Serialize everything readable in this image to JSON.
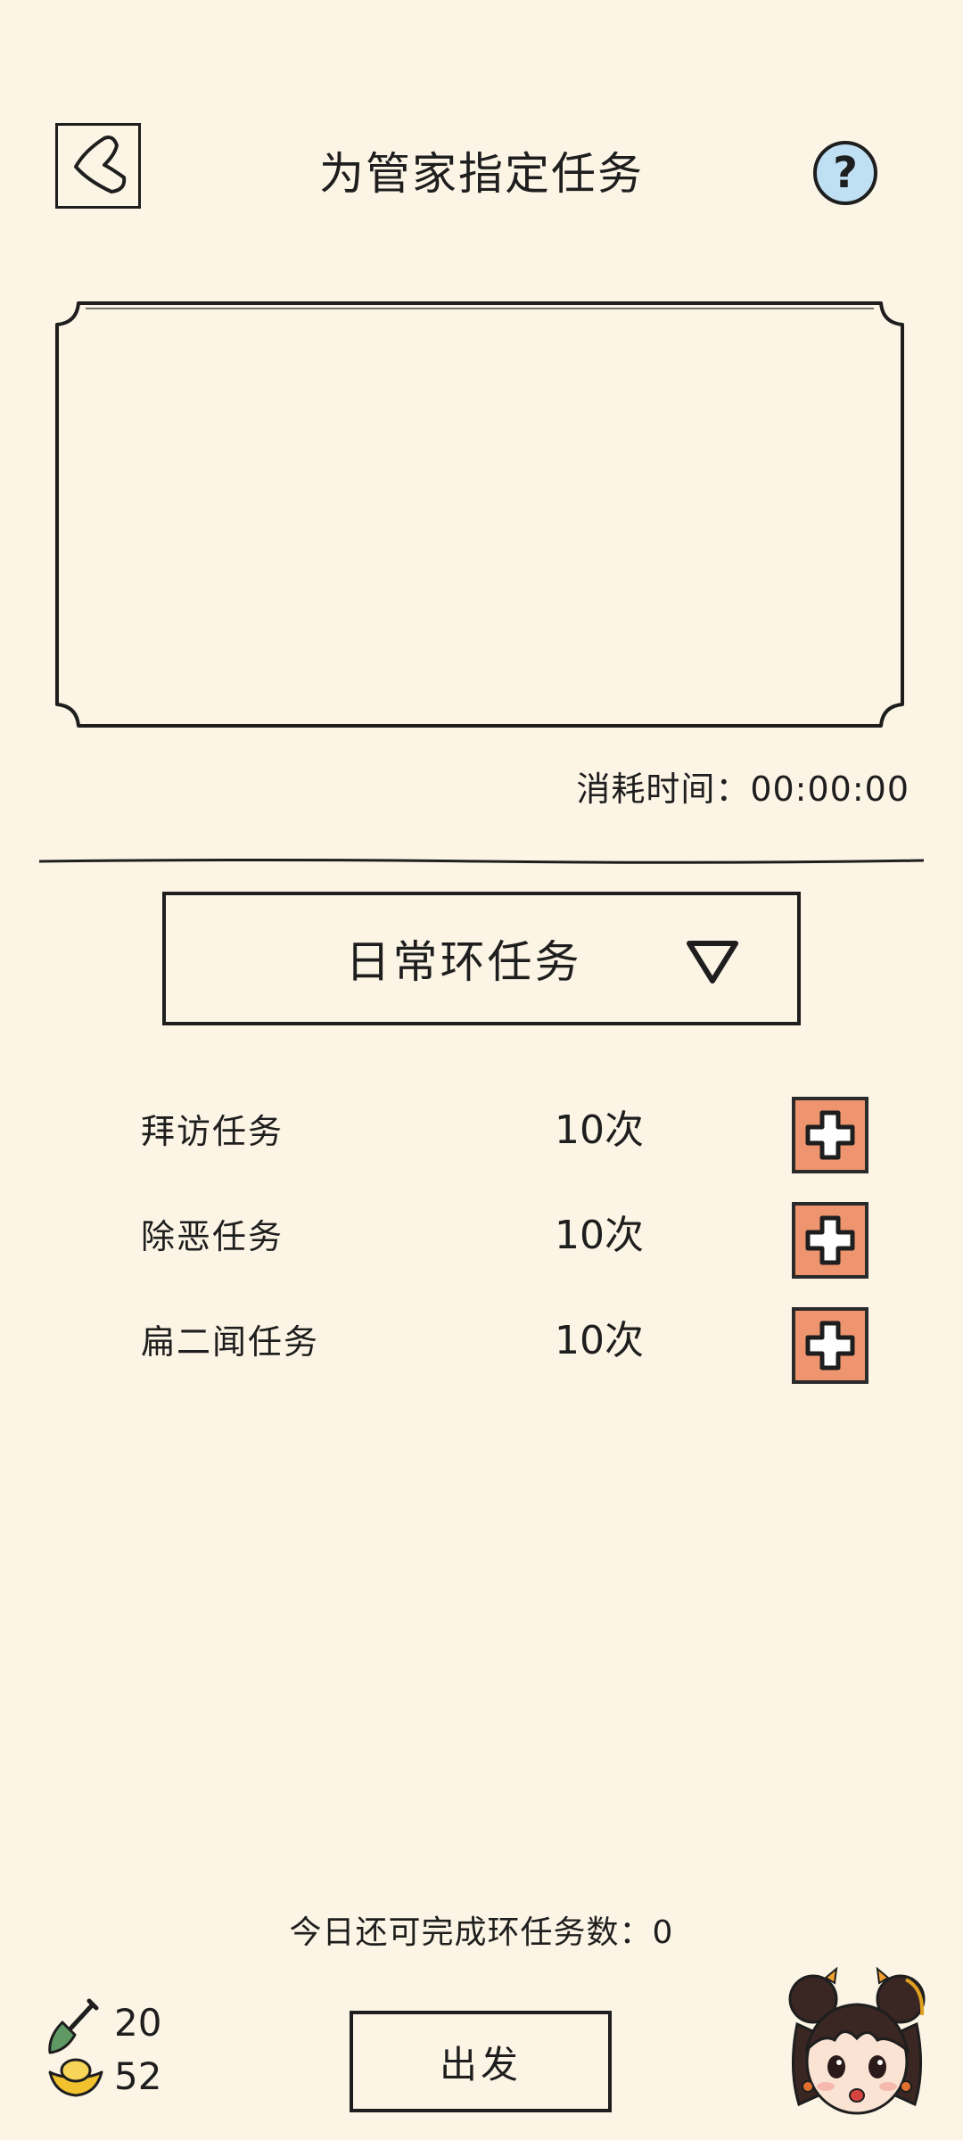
{
  "header": {
    "title": "为管家指定任务",
    "help_symbol": "?"
  },
  "task_frame": {
    "time_label": "消耗时间：",
    "time_value": "00:00:00"
  },
  "dropdown": {
    "selected": "日常环任务",
    "icon": "triangle-down-icon"
  },
  "tasks": [
    {
      "name": "拜访任务",
      "count": "10次"
    },
    {
      "name": "除恶任务",
      "count": "10次"
    },
    {
      "name": "扁二闻任务",
      "count": "10次"
    }
  ],
  "footer": {
    "remaining_label": "今日还可完成环任务数：",
    "remaining_value": "0",
    "shovel_count": "20",
    "gold_count": "52",
    "depart_label": "出发"
  },
  "colors": {
    "background": "#fcf5e6",
    "add_button": "#ee9570",
    "help_button": "#bfe0f3",
    "ink": "#1e1e1e"
  }
}
